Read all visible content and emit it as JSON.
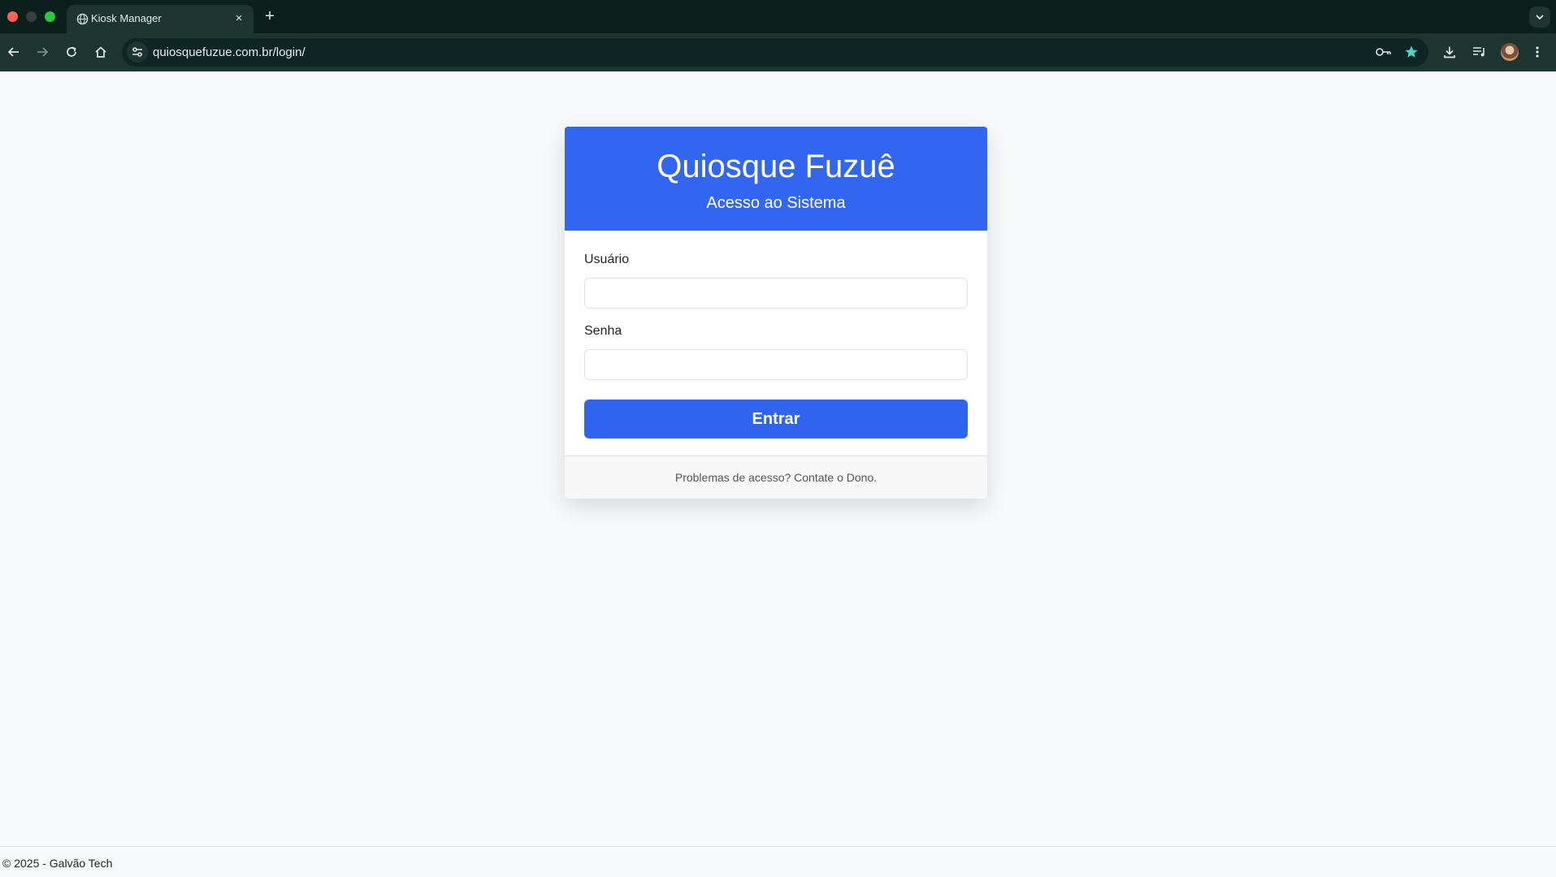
{
  "browser": {
    "tab_title": "Kiosk Manager",
    "tab_close": "×",
    "new_tab": "+",
    "url": "quiosquefuzue.com.br/login/",
    "icons": [
      "globe-icon",
      "close-icon",
      "plus-icon",
      "chevron-down-icon",
      "back-arrow-icon",
      "forward-arrow-icon",
      "reload-icon",
      "home-icon",
      "tune-icon",
      "key-icon",
      "star-icon",
      "download-icon",
      "media-queue-icon",
      "avatar",
      "more-vertical-icon"
    ],
    "accent_color": "#4fd1c5"
  },
  "login": {
    "title": "Quiosque Fuzuê",
    "subtitle": "Acesso ao Sistema",
    "username_label": "Usuário",
    "username_value": "",
    "password_label": "Senha",
    "password_value": "",
    "submit_label": "Entrar",
    "help_text": "Problemas de acesso? Contate o Dono.",
    "brand_color": "#3366f0"
  },
  "footer": {
    "copyright": "© 2025 - Galvão Tech"
  }
}
